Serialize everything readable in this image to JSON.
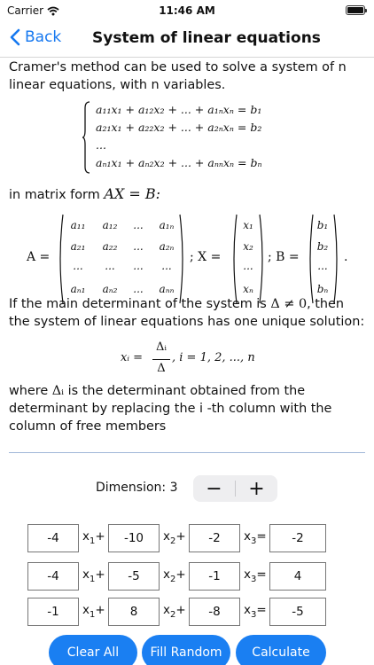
{
  "status": {
    "carrier": "Carrier",
    "time": "11:46 AM"
  },
  "nav": {
    "back_label": "Back",
    "title": "System of linear equations"
  },
  "intro": "Cramer's method can be used to solve a system of n linear equations, with n variables.",
  "system_rows": [
    "a₁₁x₁ + a₁₂x₂ + ... + a₁ₙxₙ = b₁",
    "a₂₁x₁ + a₂₂x₂ + ... + a₂ₙxₙ = b₂",
    "...",
    "aₙ₁x₁ + aₙ₂x₂ + ... + aₙₙxₙ = bₙ"
  ],
  "matrix_form": {
    "prefix": "in matrix form ",
    "equation": "AX = B:"
  },
  "matrices": {
    "A_label": "A =",
    "A": [
      [
        "a₁₁",
        "a₁₂",
        "...",
        "a₁ₙ"
      ],
      [
        "a₂₁",
        "a₂₂",
        "...",
        "a₂ₙ"
      ],
      [
        "...",
        "...",
        "...",
        "..."
      ],
      [
        "aₙ₁",
        "aₙ₂",
        "...",
        "aₙₙ"
      ]
    ],
    "X_label": "; X =",
    "X": [
      "x₁",
      "x₂",
      "...",
      "xₙ"
    ],
    "B_label": "; B =",
    "B": [
      "b₁",
      "b₂",
      "...",
      "bₙ"
    ],
    "end": "."
  },
  "determinant_text": {
    "before": "If the main determinant of the system is ",
    "math": "Δ ≠ 0",
    "after": ", then the system of linear equations has one unique solution:"
  },
  "formula": {
    "lhs": "xᵢ =",
    "numerator": "Δᵢ",
    "denominator": "Δ",
    "rhs": ", i = 1, 2, ..., n"
  },
  "where_text": {
    "before": "where ",
    "math": "Δᵢ",
    "after": " is the determinant obtained from the determinant by replacing the i -th column with the column of free members"
  },
  "dimension": {
    "label": "Dimension: 3",
    "minus": "−",
    "plus": "+"
  },
  "equations": [
    {
      "a1": "-4",
      "a2": "-10",
      "a3": "-2",
      "b": "-2"
    },
    {
      "a1": "-4",
      "a2": "-5",
      "a3": "-1",
      "b": "4"
    },
    {
      "a1": "-1",
      "a2": "8",
      "a3": "-8",
      "b": "-5"
    }
  ],
  "var_labels": {
    "x": "x",
    "sub1": "1",
    "sub2": "2",
    "sub3": "3",
    "plus": "+",
    "equals": "="
  },
  "buttons": {
    "clear": "Clear All",
    "random": "Fill Random",
    "calculate": "Calculate"
  },
  "colors": {
    "accent": "#1a7ff2"
  }
}
